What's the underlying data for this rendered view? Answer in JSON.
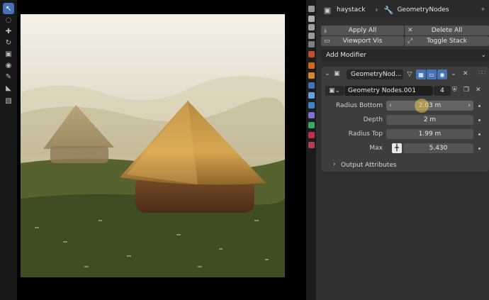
{
  "toolbar": {
    "tools": [
      "select-tool",
      "cursor-tool",
      "move-tool",
      "rotate-tool",
      "scale-tool",
      "transform-tool",
      "annotate-tool",
      "measure-tool",
      "add-cube-tool"
    ]
  },
  "header": {
    "object_name": "haystack",
    "modifier_name": "GeometryNodes"
  },
  "buttons": {
    "apply_all": "Apply All",
    "delete_all": "Delete All",
    "viewport_vis": "Viewport Vis",
    "toggle_stack": "Toggle Stack"
  },
  "add_modifier": "Add Modifier",
  "modifier": {
    "name": "GeometryNod...",
    "node_group": "Geometry Nodes.001",
    "users": "4",
    "inputs": [
      {
        "label": "Radius Bottom",
        "value": "2.03 m"
      },
      {
        "label": "Depth",
        "value": "2 m"
      },
      {
        "label": "Radius Top",
        "value": "1.99 m"
      },
      {
        "label": "Max",
        "value": "5.430"
      }
    ],
    "output_attributes": "Output Attributes"
  },
  "colors": {
    "accent": "#4772b3",
    "panel": "#303030",
    "button": "#545454",
    "highlight": "#e6c84a"
  }
}
